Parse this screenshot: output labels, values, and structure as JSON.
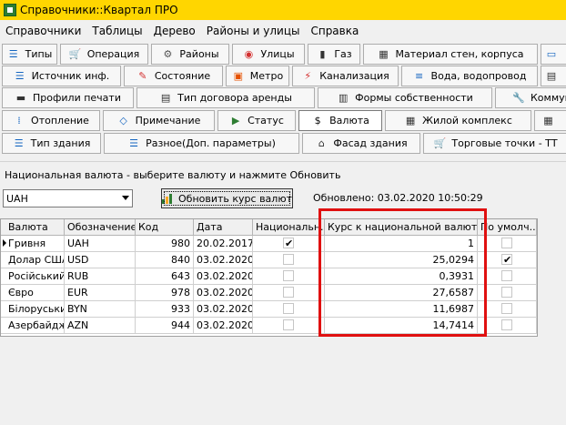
{
  "window": {
    "title": "Справочники::Квартал ПРО"
  },
  "menu": [
    "Справочники",
    "Таблицы",
    "Дерево",
    "Районы и улицы",
    "Справка"
  ],
  "toolbar_rows": [
    [
      {
        "label": "Типы",
        "icon": "list-icon"
      },
      {
        "label": "Операция",
        "icon": "cart-icon"
      },
      {
        "label": "Районы",
        "icon": "gear-icon"
      },
      {
        "label": "Улицы",
        "icon": "pin-icon"
      },
      {
        "label": "Газ",
        "icon": "gas-icon"
      },
      {
        "label": "Материал стен, корпуса",
        "icon": "wall-icon"
      },
      {
        "label": "",
        "icon": "monitor-icon"
      }
    ],
    [
      {
        "label": "Источник инф.",
        "icon": "list-icon"
      },
      {
        "label": "Состояние",
        "icon": "state-icon"
      },
      {
        "label": "Метро",
        "icon": "metro-icon"
      },
      {
        "label": "Канализация",
        "icon": "sewer-icon"
      },
      {
        "label": "Вода, водопровод",
        "icon": "water-icon"
      },
      {
        "label": "",
        "icon": "doc-icon"
      }
    ],
    [
      {
        "label": "Профили печати",
        "icon": "print-icon"
      },
      {
        "label": "Тип договора аренды",
        "icon": "doc-icon"
      },
      {
        "label": "Формы собственности",
        "icon": "card-icon"
      },
      {
        "label": "Коммун",
        "icon": "wrench-icon"
      }
    ],
    [
      {
        "label": "Отопление",
        "icon": "heat-icon"
      },
      {
        "label": "Примечание",
        "icon": "tag-icon"
      },
      {
        "label": "Статус",
        "icon": "flag-icon"
      },
      {
        "label": "Валюта",
        "icon": "coin-icon"
      },
      {
        "label": "Жилой комплекс",
        "icon": "building-icon"
      },
      {
        "label": "",
        "icon": "grid-icon"
      }
    ],
    [
      {
        "label": "Тип здания",
        "icon": "list-icon"
      },
      {
        "label": "Разное(Доп. параметры)",
        "icon": "list-icon"
      },
      {
        "label": "Фасад здания",
        "icon": "house-icon"
      },
      {
        "label": "Торговые точки - ТТ",
        "icon": "cart-icon"
      }
    ]
  ],
  "panel": {
    "info": "Национальная валюта - выберите валюту и нажмите Обновить",
    "selected_currency": "UAH",
    "update_button": "Обновить курс валют",
    "updated_label": "Обновлено:",
    "updated_value": "03.02.2020 10:50:29"
  },
  "table": {
    "columns": [
      "Валюта",
      "Обозначение",
      "Код",
      "Дата",
      "Национальн...",
      "Курс к национальной валюте",
      "По умолч..."
    ],
    "rows": [
      {
        "name": "Гривня",
        "symbol": "UAH",
        "code": "980",
        "date": "20.02.2017",
        "national": true,
        "rate": "1",
        "default": false
      },
      {
        "name": "Долар США",
        "symbol": "USD",
        "code": "840",
        "date": "03.02.2020",
        "national": false,
        "rate": "25,0294",
        "default": true
      },
      {
        "name": "Російський р",
        "symbol": "RUB",
        "code": "643",
        "date": "03.02.2020",
        "national": false,
        "rate": "0,3931",
        "default": false
      },
      {
        "name": "Євро",
        "symbol": "EUR",
        "code": "978",
        "date": "03.02.2020",
        "national": false,
        "rate": "27,6587",
        "default": false
      },
      {
        "name": "Білоруський",
        "symbol": "BYN",
        "code": "933",
        "date": "03.02.2020",
        "national": false,
        "rate": "11,6987",
        "default": false
      },
      {
        "name": "Азербайджа",
        "symbol": "AZN",
        "code": "944",
        "date": "03.02.2020",
        "national": false,
        "rate": "14,7414",
        "default": false
      }
    ]
  }
}
